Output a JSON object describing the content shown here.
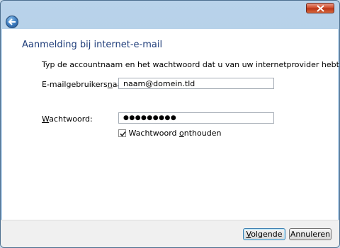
{
  "window": {
    "heading": "Aanmelding bij internet-e-mail",
    "intro": "Typ de accountnaam en het wachtwoord dat u van uw internetprovider hebt gekregen."
  },
  "form": {
    "username_label_pre": "E-mailgebruikers",
    "username_label_ul": "n",
    "username_label_post": "aam:",
    "username_value": "naam@domein.tld",
    "password_label_ul": "W",
    "password_label_post": "achtwoord:",
    "password_value": "●●●●●●●●●",
    "remember_label_pre": "Wachtwoord ",
    "remember_label_ul": "o",
    "remember_label_post": "nthouden",
    "remember_checked": true
  },
  "buttons": {
    "next_pre": "",
    "next_ul": "V",
    "next_post": "olgende",
    "cancel": "Annuleren"
  },
  "icons": {
    "close": "close-icon",
    "back": "back-arrow-icon",
    "check": "checkmark-icon"
  }
}
